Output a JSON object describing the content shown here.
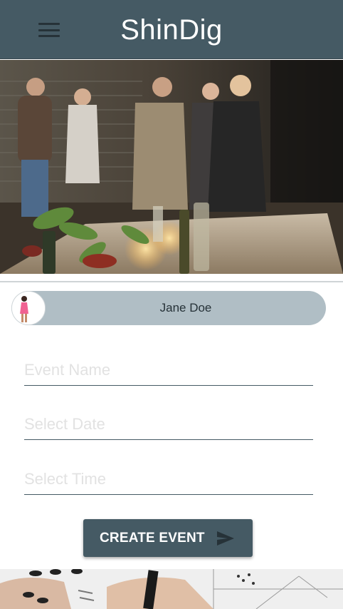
{
  "app": {
    "title": "ShinDig"
  },
  "header": {
    "menu_icon": "hamburger-menu-icon"
  },
  "profile": {
    "name": "Jane Doe",
    "avatar_icon": "user-avatar"
  },
  "form": {
    "event_name_placeholder": "Event Name",
    "date_placeholder": "Select Date",
    "time_placeholder": "Select Time"
  },
  "actions": {
    "create_label": "CREATE EVENT",
    "create_icon": "send-icon"
  },
  "colors": {
    "primary": "#455a64",
    "chip": "#b0bec5",
    "text_dark": "#263238",
    "white": "#ffffff"
  }
}
